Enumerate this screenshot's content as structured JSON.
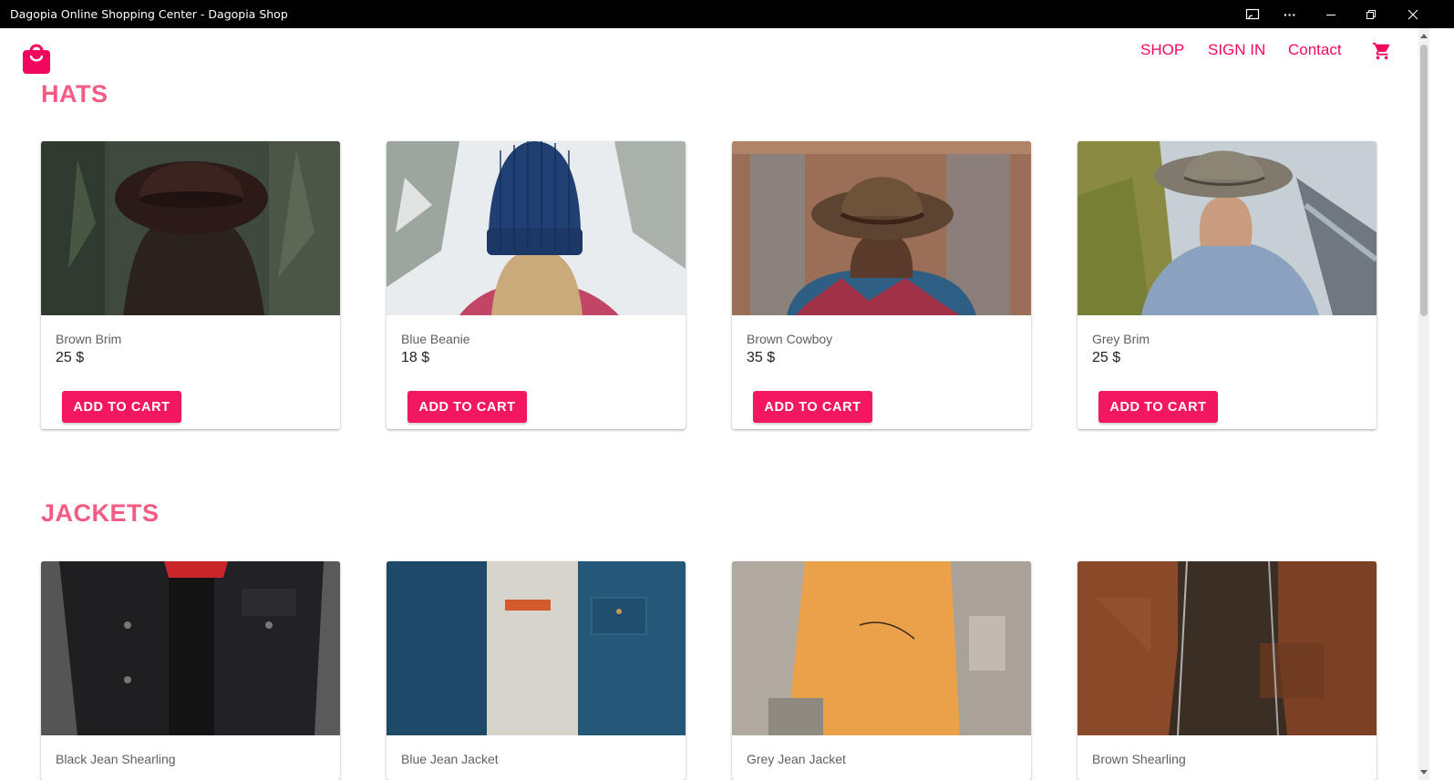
{
  "window": {
    "title": "Dagopia Online Shopping Center - Dagopia Shop",
    "more_label": "···"
  },
  "header": {
    "nav": [
      "SHOP",
      "SIGN IN",
      "Contact"
    ],
    "accent_color": "#f2075f"
  },
  "sections": [
    {
      "title": "HATS",
      "products": [
        {
          "name": "Brown Brim",
          "price": "25 $",
          "button": "ADD TO CART"
        },
        {
          "name": "Blue Beanie",
          "price": "18 $",
          "button": "ADD TO CART"
        },
        {
          "name": "Brown Cowboy",
          "price": "35 $",
          "button": "ADD TO CART"
        },
        {
          "name": "Grey Brim",
          "price": "25 $",
          "button": "ADD TO CART"
        }
      ]
    },
    {
      "title": "JACKETS",
      "products": [
        {
          "name": "Black Jean Shearling"
        },
        {
          "name": "Blue Jean Jacket"
        },
        {
          "name": "Grey Jean Jacket"
        },
        {
          "name": "Brown Shearling"
        }
      ]
    }
  ],
  "icons": {
    "logo": "shopping-bag-icon",
    "cart": "cart-icon",
    "window_controls": [
      "cast-icon",
      "more-icon",
      "minimize-icon",
      "restore-icon",
      "close-icon"
    ]
  }
}
